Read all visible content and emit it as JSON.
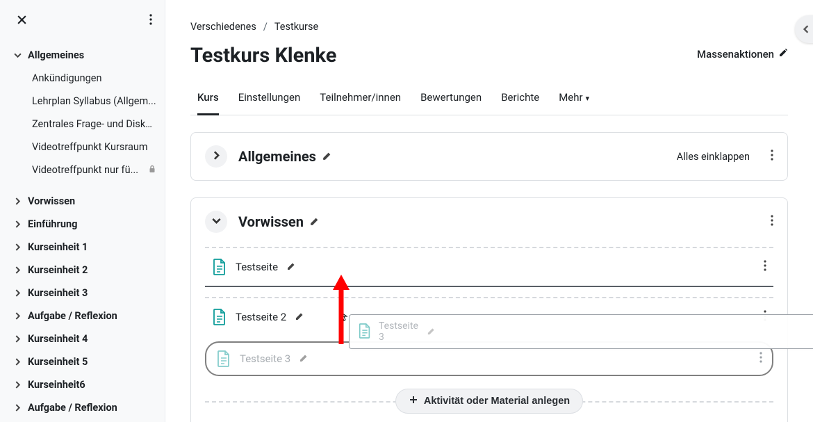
{
  "breadcrumb": {
    "a": "Verschiedenes",
    "b": "Testkurse"
  },
  "course_title": "Testkurs Klenke",
  "massactions_label": "Massenaktionen",
  "tabs": {
    "kurs": "Kurs",
    "einstellungen": "Einstellungen",
    "teilnehmer": "Teilnehmer/innen",
    "bewertungen": "Bewertungen",
    "berichte": "Berichte",
    "mehr": "Mehr"
  },
  "collapse_all": "Alles einklappen",
  "sections": {
    "allgemeines": "Allgemeines",
    "vorwissen": "Vorwissen"
  },
  "activities": {
    "t1": "Testseite",
    "t2": "Testseite 2",
    "t3": "Testseite 3",
    "t3_ghost": "Testseite 3"
  },
  "add_activity": "Aktivität oder Material anlegen",
  "sidebar": {
    "allgemeines": "Allgemeines",
    "items_sub": [
      "Ankündigungen",
      "Lehrplan Syllabus (Allgem...",
      "Zentrales Frage- und Disku...",
      "Videotreffpunkt Kursraum",
      "Videotreffpunkt nur fü..."
    ],
    "items": [
      "Vorwissen",
      "Einführung",
      "Kurseinheit 1",
      "Kurseinheit 2",
      "Kurseinheit 3",
      "Aufgabe / Reflexion",
      "Kurseinheit 4",
      "Kurseinheit 5",
      "Kurseinheit6",
      "Aufgabe / Reflexion"
    ]
  }
}
